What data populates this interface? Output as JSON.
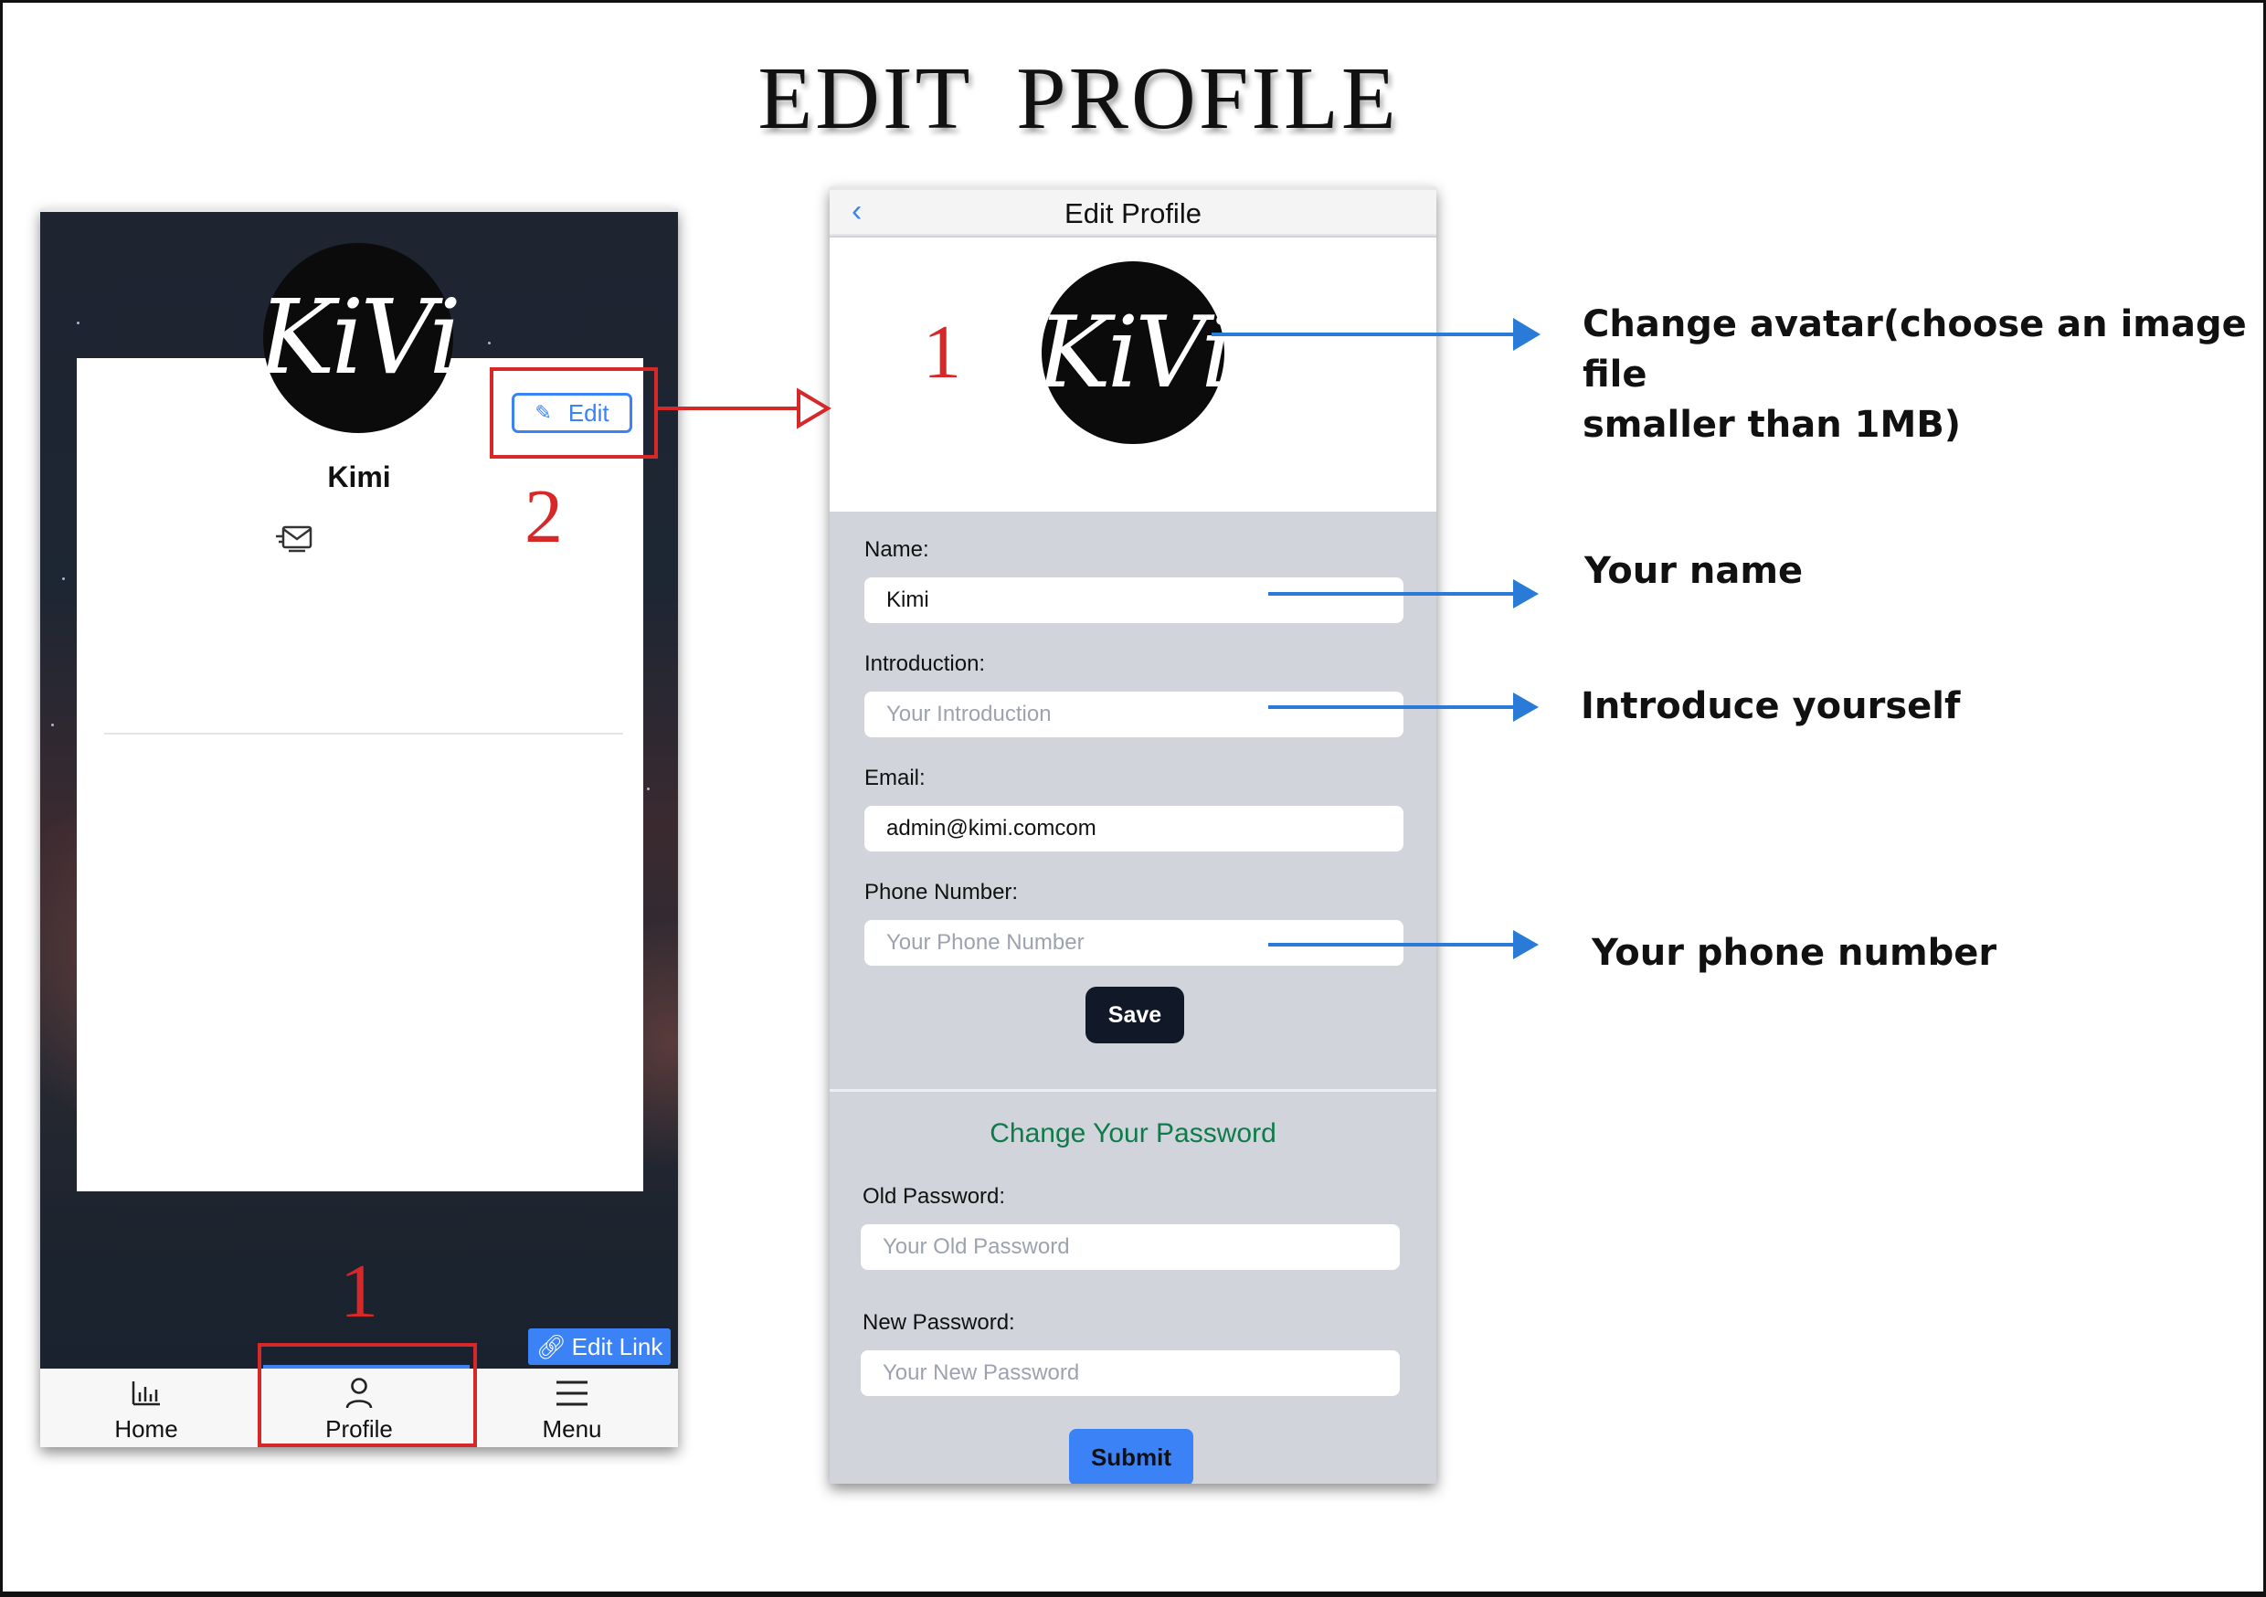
{
  "doc_title": "EDIT  PROFILE",
  "left_screen": {
    "avatar_text": "KiVi",
    "edit_button_label": "Edit",
    "profile_name": "Kimi",
    "edit_link_label": "Edit Link",
    "tabs": [
      {
        "label": "Home",
        "icon": "bar-chart-icon"
      },
      {
        "label": "Profile",
        "icon": "person-icon"
      },
      {
        "label": "Menu",
        "icon": "hamburger-menu-icon"
      }
    ],
    "active_tab": "Profile",
    "step_1": "1",
    "step_2": "2"
  },
  "right_screen": {
    "nav_back": "‹",
    "nav_title": "Edit Profile",
    "avatar_text": "KiVi",
    "step_1": "1",
    "fields": {
      "name": {
        "label": "Name:",
        "value": "Kimi"
      },
      "introduction": {
        "label": "Introduction:",
        "placeholder": "Your Introduction"
      },
      "email": {
        "label": "Email:",
        "value": "admin@kimi.comcom"
      },
      "phone": {
        "label": "Phone Number:",
        "placeholder": "Your Phone Number"
      }
    },
    "save_label": "Save",
    "password_section_title": "Change Your Password",
    "old_password": {
      "label": "Old Password:",
      "placeholder": "Your Old Password"
    },
    "new_password": {
      "label": "New Password:",
      "placeholder": "Your New Password"
    },
    "submit_label": "Submit"
  },
  "annotations": {
    "avatar_line1": "Change avatar(choose an image file",
    "avatar_line2": "smaller than 1MB)",
    "name": "Your name",
    "introduction": "Introduce yourself",
    "phone": "Your phone number"
  },
  "colors": {
    "accent_blue": "#3b82f6",
    "annotation_red": "#d62828",
    "arrow_blue": "#2a7bd8",
    "password_title_green": "#0e7b4a",
    "form_bg": "#d1d5db",
    "save_button": "#111827"
  }
}
